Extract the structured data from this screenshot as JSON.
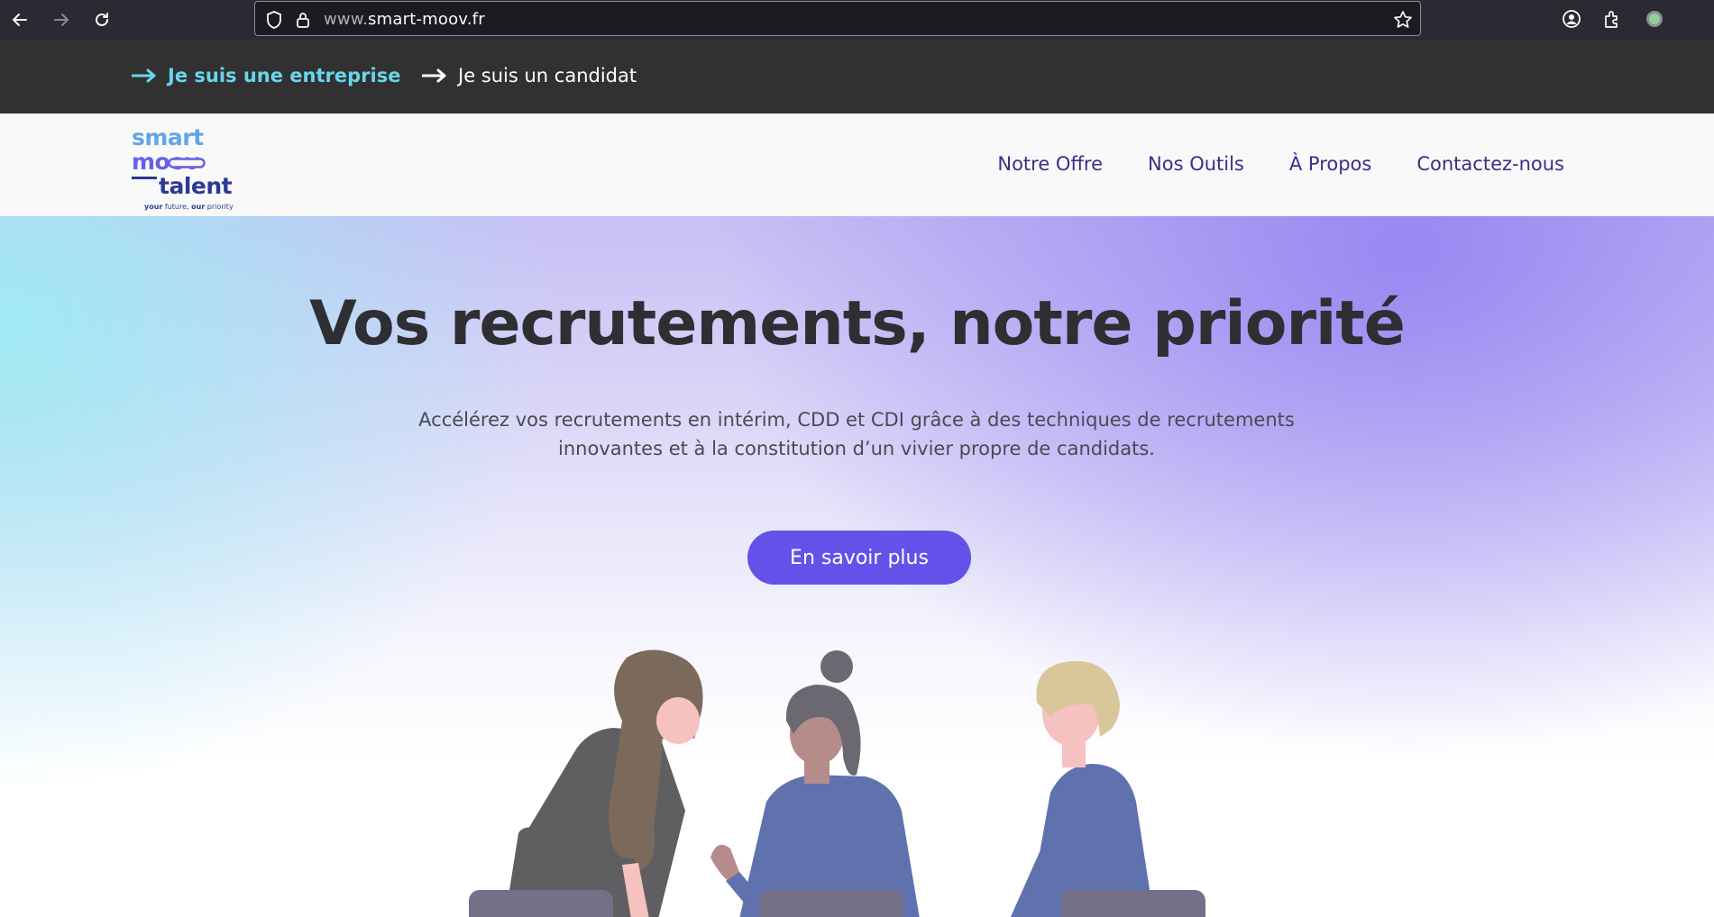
{
  "browser": {
    "url_prefix": "www.",
    "url_domain": "smart-moov.fr",
    "icons": [
      "back-arrow-icon",
      "forward-arrow-icon",
      "reload-icon",
      "shield-icon",
      "lock-icon",
      "star-icon",
      "account-icon",
      "extensions-icon",
      "profile-dot-icon"
    ]
  },
  "audience": {
    "company_label": "Je suis une entreprise",
    "candidate_label": "Je suis un candidat",
    "active_color": "#67d6ec"
  },
  "header": {
    "logo": {
      "line1": "smart",
      "line2": "moov",
      "line3": "talent",
      "tagline_a": "your",
      "tagline_b": " future, ",
      "tagline_c": "our",
      "tagline_d": " priority"
    },
    "nav": [
      {
        "label": "Notre Offre"
      },
      {
        "label": "Nos Outils"
      },
      {
        "label": "À Propos"
      },
      {
        "label": "Contactez-nous"
      }
    ],
    "nav_color": "#3a2f86"
  },
  "hero": {
    "title": "Vos recrutements, notre priorité",
    "subtitle_line1": "Accélérez vos recrutements en intérim, CDD et CDI grâce à des techniques de recrutements",
    "subtitle_line2": "innovantes et à la constitution d’un vivier propre de candidats.",
    "cta_label": "En savoir plus",
    "cta_color": "#6351ea"
  }
}
